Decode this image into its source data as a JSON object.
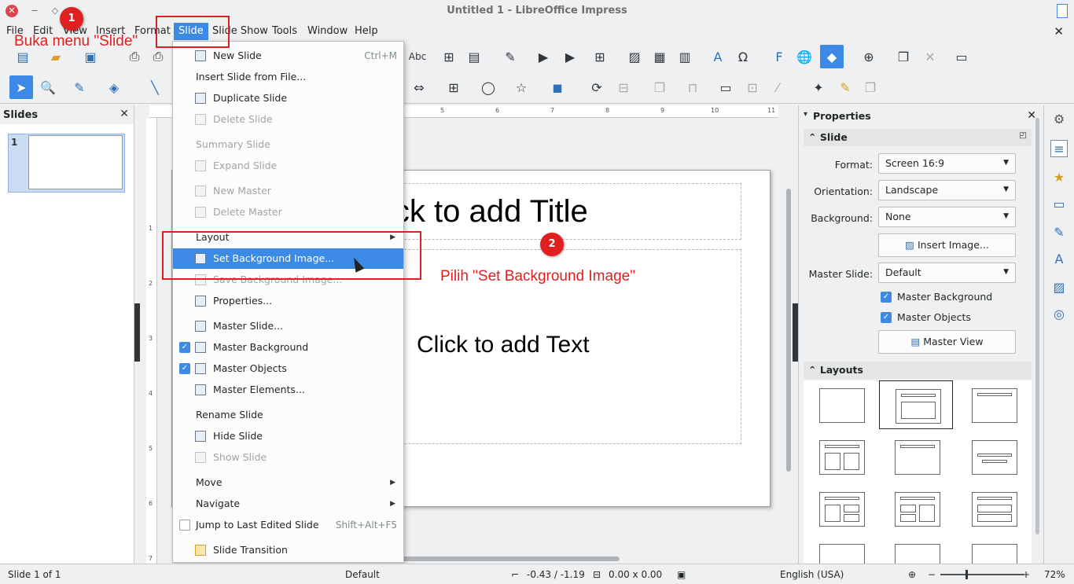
{
  "window": {
    "title": "Untitled 1 - LibreOffice Impress"
  },
  "menubar": {
    "items": [
      "File",
      "Edit",
      "View",
      "Insert",
      "Format",
      "Slide",
      "Slide Show",
      "Tools",
      "Window",
      "Help"
    ],
    "active": "Slide"
  },
  "slide_menu": {
    "items": [
      {
        "label": "New Slide",
        "shortcut": "Ctrl+M",
        "icon": "new-slide-icon",
        "disabled": false
      },
      {
        "label": "Insert Slide from File...",
        "shortcut": "",
        "icon": "",
        "disabled": false
      },
      {
        "label": "Duplicate Slide",
        "shortcut": "",
        "icon": "duplicate-slide-icon",
        "disabled": false
      },
      {
        "label": "Delete Slide",
        "shortcut": "",
        "icon": "delete-slide-icon",
        "disabled": true
      },
      {
        "label": "Summary Slide",
        "shortcut": "",
        "icon": "",
        "disabled": true
      },
      {
        "label": "Expand Slide",
        "shortcut": "",
        "icon": "expand-slide-icon",
        "disabled": true
      },
      {
        "label": "New Master",
        "shortcut": "",
        "icon": "new-master-icon",
        "disabled": true
      },
      {
        "label": "Delete Master",
        "shortcut": "",
        "icon": "delete-master-icon",
        "disabled": true
      },
      {
        "label": "Layout",
        "shortcut": "",
        "icon": "",
        "disabled": false,
        "submenu": true
      },
      {
        "label": "Set Background Image...",
        "shortcut": "",
        "icon": "background-image-icon",
        "disabled": false,
        "highlighted": true
      },
      {
        "label": "Save Background Image...",
        "shortcut": "",
        "icon": "save-background-icon",
        "disabled": true
      },
      {
        "label": "Properties...",
        "shortcut": "",
        "icon": "properties-icon",
        "disabled": false
      },
      {
        "label": "Master Slide...",
        "shortcut": "",
        "icon": "master-slide-icon",
        "disabled": false
      },
      {
        "label": "Master Background",
        "shortcut": "",
        "icon": "master-background-icon",
        "disabled": false,
        "checked": true
      },
      {
        "label": "Master Objects",
        "shortcut": "",
        "icon": "master-objects-icon",
        "disabled": false,
        "checked": true
      },
      {
        "label": "Master Elements...",
        "shortcut": "",
        "icon": "master-elements-icon",
        "disabled": false
      },
      {
        "label": "Rename Slide",
        "shortcut": "",
        "icon": "",
        "disabled": false
      },
      {
        "label": "Hide Slide",
        "shortcut": "",
        "icon": "hide-slide-icon",
        "disabled": false
      },
      {
        "label": "Show Slide",
        "shortcut": "",
        "icon": "show-slide-icon",
        "disabled": true
      },
      {
        "label": "Move",
        "shortcut": "",
        "icon": "",
        "disabled": false,
        "submenu": true
      },
      {
        "label": "Navigate",
        "shortcut": "",
        "icon": "",
        "disabled": false,
        "submenu": true
      },
      {
        "label": "Jump to Last Edited Slide",
        "shortcut": "Shift+Alt+F5",
        "icon": "",
        "disabled": false,
        "checkbox": true
      },
      {
        "label": "Slide Transition",
        "shortcut": "",
        "icon": "slide-transition-icon",
        "disabled": false
      }
    ]
  },
  "slides_pane": {
    "title": "Slides",
    "slide_number": "1"
  },
  "slide": {
    "title_placeholder": "Click to add Title",
    "text_placeholder": "Click to add Text"
  },
  "ruler": {
    "h_ticks": [
      "5",
      "6",
      "7",
      "8",
      "9",
      "10",
      "11"
    ],
    "v_ticks": [
      "1",
      "2",
      "3",
      "4",
      "5",
      "6",
      "7"
    ]
  },
  "properties": {
    "title": "Properties",
    "slide_section": "Slide",
    "format_label": "Format:",
    "format_value": "Screen 16:9",
    "orientation_label": "Orientation:",
    "orientation_value": "Landscape",
    "background_label": "Background:",
    "background_value": "None",
    "insert_image_button": "Insert Image...",
    "master_slide_label": "Master Slide:",
    "master_slide_value": "Default",
    "master_background": "Master Background",
    "master_objects": "Master Objects",
    "master_view_button": "Master View",
    "layouts_section": "Layouts"
  },
  "statusbar": {
    "slide_info": "Slide 1 of 1",
    "master": "Default",
    "position": "-0.43 / -1.19",
    "size": "0.00 x 0.00",
    "language": "English (USA)",
    "zoom": "72%"
  },
  "annotations": {
    "step1_number": "1",
    "step1_text": "Buka menu \"Slide\"",
    "step2_number": "2",
    "step2_text": "Pilih \"Set Background Image\""
  },
  "colors": {
    "accent": "#3d8ae6",
    "annotation": "#e02020"
  }
}
